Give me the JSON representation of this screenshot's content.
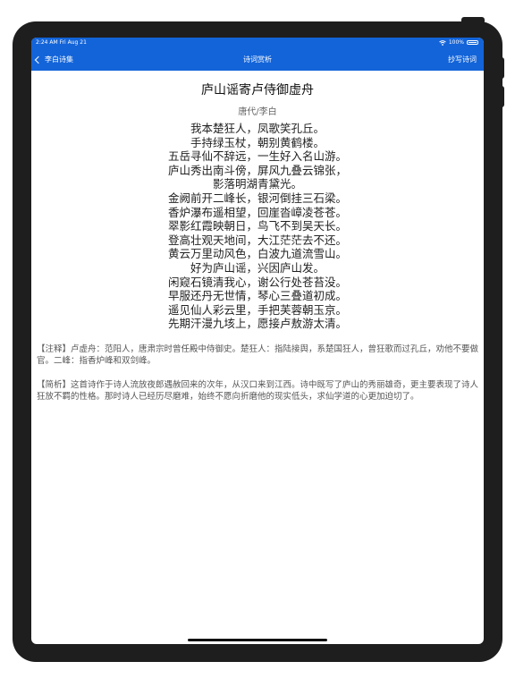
{
  "status": {
    "time": "2:24 AM  Fri Aug 21",
    "battery": "100%"
  },
  "nav": {
    "back_label": "李白诗集",
    "title": "诗词赏析",
    "right_label": "抄写诗词"
  },
  "poem": {
    "title": "庐山谣寄卢侍御虚舟",
    "author": "唐代/李白",
    "lines": [
      "我本楚狂人，凤歌笑孔丘。",
      "手持绿玉杖，朝别黄鹤楼。",
      "五岳寻仙不辞远，一生好入名山游。",
      "庐山秀出南斗傍，屏风九叠云锦张，",
      "影落明湖青黛光。",
      "金阙前开二峰长，银河倒挂三石梁。",
      "香炉瀑布遥相望，回崖沓嶂凌苍苍。",
      "翠影红霞映朝日，鸟飞不到吴天长。",
      "登高壮观天地间，大江茫茫去不还。",
      "黄云万里动风色，白波九道流雪山。",
      "好为庐山谣，兴因庐山发。",
      "闲窥石镜清我心，谢公行处苍苔没。",
      "早服还丹无世情，琴心三叠道初成。",
      "遥见仙人彩云里，手把芙蓉朝玉京。",
      "先期汗漫九垓上，愿接卢敖游太清。"
    ]
  },
  "notes": {
    "annotation": "【注释】卢虚舟：范阳人，唐肃宗时曾任殿中侍御史。楚狂人：指陆接舆，系楚国狂人，曾狂歌而过孔丘，劝他不要做官。二峰：指香炉峰和双剑峰。",
    "analysis": "【简析】这首诗作于诗人流放夜郎遇赦回来的次年，从汉口来到江西。诗中既写了庐山的秀丽雄奇，更主要表现了诗人狂放不羁的性格。那时诗人已经历尽磨难，始终不愿向折磨他的现实低头，求仙学道的心更加迫切了。"
  },
  "colors": {
    "nav_bar": "#1364d9",
    "device_frame": "#1e1e1e"
  }
}
